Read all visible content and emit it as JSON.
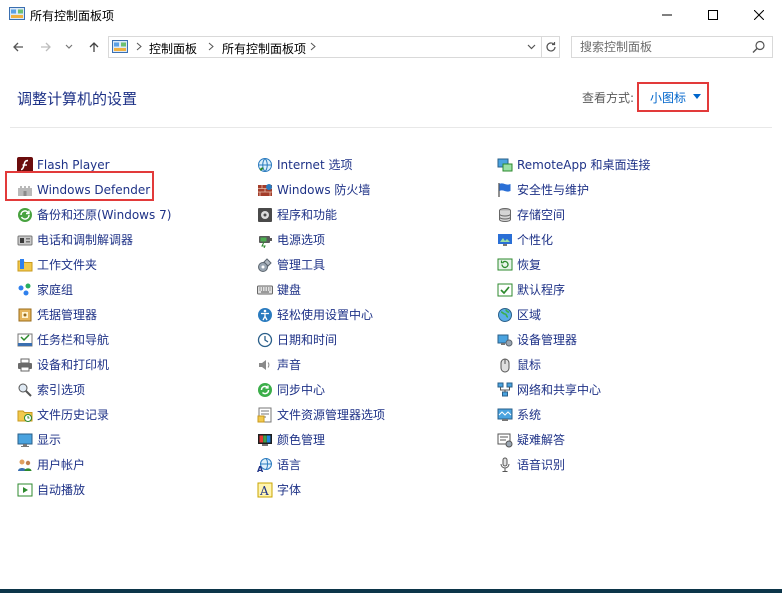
{
  "window": {
    "title": "所有控制面板项"
  },
  "nav": {
    "breadcrumbs": [
      "控制面板",
      "所有控制面板项"
    ],
    "search_placeholder": "搜索控制面板"
  },
  "header": {
    "title": "调整计算机的设置",
    "view_by_label": "查看方式:",
    "view_by_value": "小图标"
  },
  "columns": [
    [
      {
        "label": "Flash Player",
        "icon": "flash-icon"
      },
      {
        "label": "Windows Defender",
        "icon": "defender-castle-icon"
      },
      {
        "label": "备份和还原(Windows 7)",
        "icon": "backup-icon"
      },
      {
        "label": "电话和调制解调器",
        "icon": "phone-modem-icon"
      },
      {
        "label": "工作文件夹",
        "icon": "work-folder-icon"
      },
      {
        "label": "家庭组",
        "icon": "homegroup-icon"
      },
      {
        "label": "凭据管理器",
        "icon": "credential-icon"
      },
      {
        "label": "任务栏和导航",
        "icon": "taskbar-icon"
      },
      {
        "label": "设备和打印机",
        "icon": "printer-icon"
      },
      {
        "label": "索引选项",
        "icon": "indexing-icon"
      },
      {
        "label": "文件历史记录",
        "icon": "file-history-icon"
      },
      {
        "label": "显示",
        "icon": "display-icon"
      },
      {
        "label": "用户帐户",
        "icon": "user-accounts-icon"
      },
      {
        "label": "自动播放",
        "icon": "autoplay-icon"
      }
    ],
    [
      {
        "label": "Internet 选项",
        "icon": "internet-options-icon"
      },
      {
        "label": "Windows 防火墙",
        "icon": "firewall-icon"
      },
      {
        "label": "程序和功能",
        "icon": "programs-icon"
      },
      {
        "label": "电源选项",
        "icon": "power-icon"
      },
      {
        "label": "管理工具",
        "icon": "admin-tools-icon"
      },
      {
        "label": "键盘",
        "icon": "keyboard-icon"
      },
      {
        "label": "轻松使用设置中心",
        "icon": "ease-of-access-icon"
      },
      {
        "label": "日期和时间",
        "icon": "clock-icon"
      },
      {
        "label": "声音",
        "icon": "speaker-icon"
      },
      {
        "label": "同步中心",
        "icon": "sync-icon"
      },
      {
        "label": "文件资源管理器选项",
        "icon": "folder-options-icon"
      },
      {
        "label": "颜色管理",
        "icon": "color-management-icon"
      },
      {
        "label": "语言",
        "icon": "language-icon"
      },
      {
        "label": "字体",
        "icon": "font-icon"
      }
    ],
    [
      {
        "label": "RemoteApp 和桌面连接",
        "icon": "remoteapp-icon"
      },
      {
        "label": "安全性与维护",
        "icon": "flag-icon"
      },
      {
        "label": "存储空间",
        "icon": "storage-icon"
      },
      {
        "label": "个性化",
        "icon": "personalization-icon"
      },
      {
        "label": "恢复",
        "icon": "recovery-icon"
      },
      {
        "label": "默认程序",
        "icon": "default-programs-icon"
      },
      {
        "label": "区域",
        "icon": "region-globe-icon"
      },
      {
        "label": "设备管理器",
        "icon": "device-manager-icon"
      },
      {
        "label": "鼠标",
        "icon": "mouse-icon"
      },
      {
        "label": "网络和共享中心",
        "icon": "network-icon"
      },
      {
        "label": "系统",
        "icon": "system-icon"
      },
      {
        "label": "疑难解答",
        "icon": "troubleshooting-icon"
      },
      {
        "label": "语音识别",
        "icon": "microphone-icon"
      }
    ]
  ]
}
